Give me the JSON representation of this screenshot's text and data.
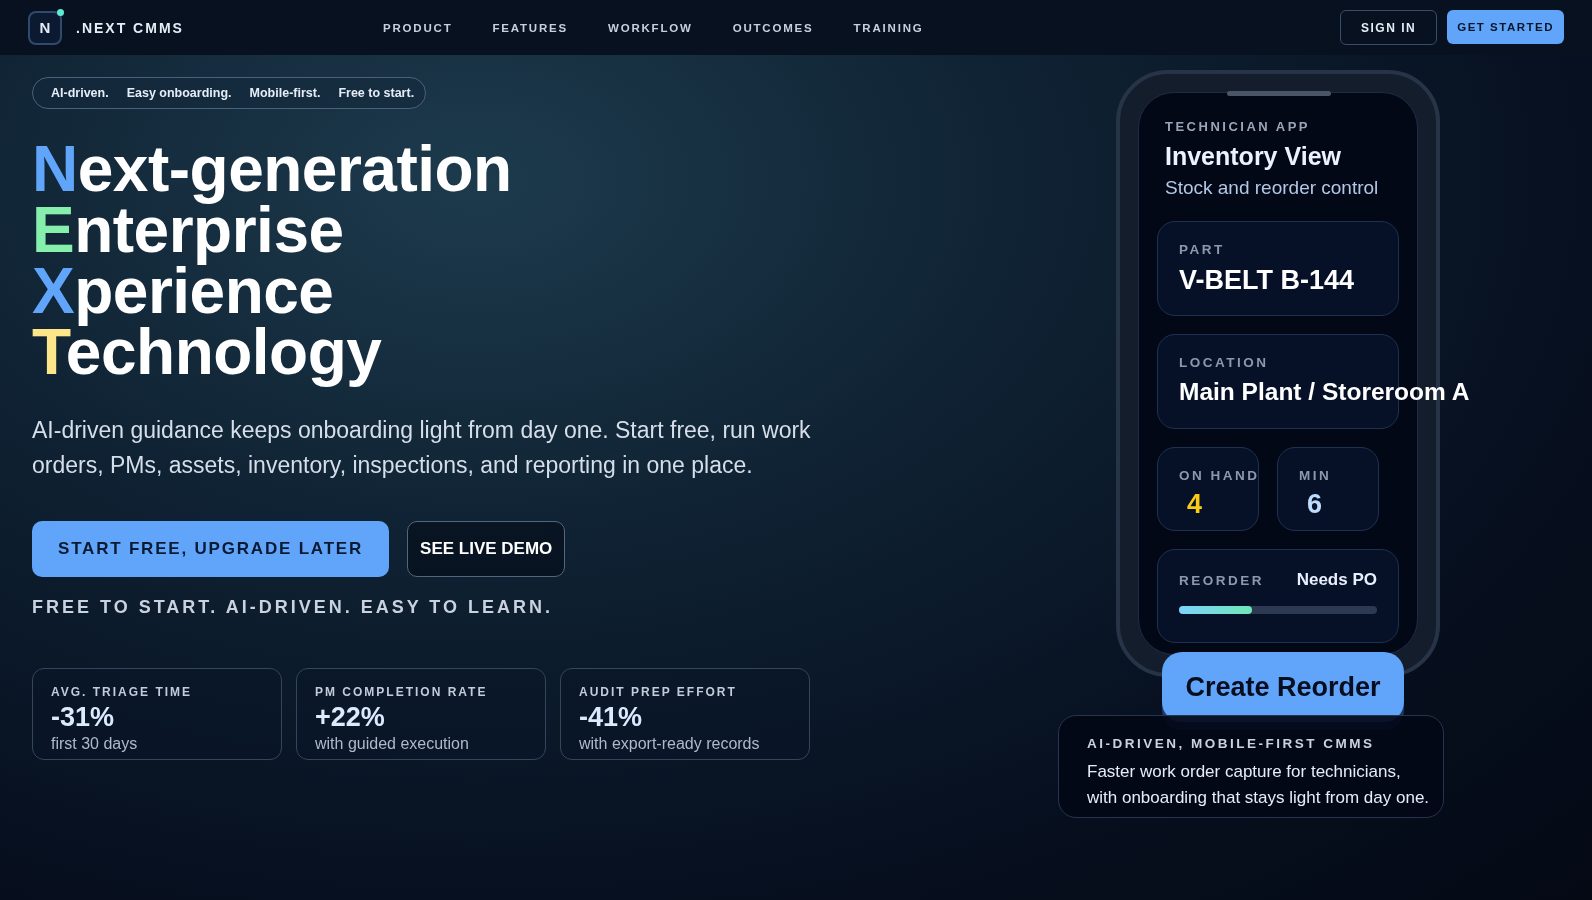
{
  "nav": {
    "logo_letter": "N",
    "brand": ".NEXT CMMS",
    "links": [
      "PRODUCT",
      "FEATURES",
      "WORKFLOW",
      "OUTCOMES",
      "TRAINING"
    ],
    "sign_in": "SIGN IN",
    "get_started": "GET STARTED"
  },
  "pill_tags": [
    "AI-driven.",
    "Easy onboarding.",
    "Mobile-first.",
    "Free to start."
  ],
  "headline": [
    {
      "accent": "N",
      "text": "ext-generation",
      "color": "#60a5fa"
    },
    {
      "accent": "E",
      "text": "nterprise",
      "color": "#86efac"
    },
    {
      "accent": "X",
      "text": "perience",
      "color": "#60a5fa"
    },
    {
      "accent": "T",
      "text": "echnology",
      "color": "#fde68a"
    }
  ],
  "lead": "AI-driven guidance keeps onboarding light from day one. Start free, run work orders, PMs, assets, inventory, inspections, and reporting in one place.",
  "primary_cta": "START FREE, UPGRADE LATER",
  "secondary_cta": "SEE LIVE DEMO",
  "tagline": "FREE TO START. AI-DRIVEN. EASY TO LEARN.",
  "stats": [
    {
      "label": "AVG. TRIAGE TIME",
      "value": "-31%",
      "note": "first 30 days"
    },
    {
      "label": "PM COMPLETION RATE",
      "value": "+22%",
      "note": "with guided execution"
    },
    {
      "label": "AUDIT PREP EFFORT",
      "value": "-41%",
      "note": "with export-ready records"
    }
  ],
  "phone": {
    "eyebrow": "TECHNICIAN APP",
    "title": "Inventory View",
    "subtitle": "Stock and reorder control",
    "part": {
      "label": "PART",
      "value": "V-BELT B-144"
    },
    "location": {
      "label": "LOCATION",
      "value": "Main Plant / Storeroom A"
    },
    "counts": [
      {
        "label": "ON HAND",
        "value": "4",
        "color": "#facc15"
      },
      {
        "label": "MIN",
        "value": "6",
        "color": "#bfdbfe"
      }
    ],
    "reorder": {
      "label": "REORDER",
      "status": "Needs PO",
      "level": 0.37
    },
    "action": "Create Reorder"
  },
  "info_card": {
    "title": "AI-DRIVEN, MOBILE-FIRST CMMS",
    "text": "Faster work order capture for technicians, with onboarding that stays light from day one."
  }
}
